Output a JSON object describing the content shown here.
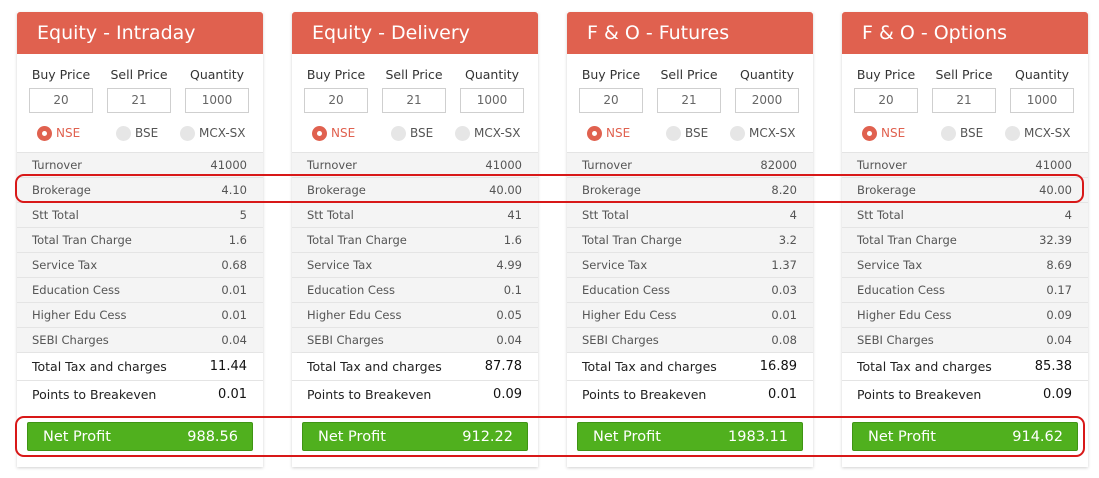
{
  "labels": {
    "buy": "Buy Price",
    "sell": "Sell Price",
    "qty": "Quantity",
    "exchanges": [
      "NSE",
      "BSE",
      "MCX-SX"
    ],
    "rows": [
      "Turnover",
      "Brokerage",
      "Stt Total",
      "Total Tran Charge",
      "Service Tax",
      "Education Cess",
      "Higher Edu Cess",
      "SEBI Charges",
      "Total Tax and charges",
      "Points to Breakeven"
    ],
    "net_profit": "Net Profit"
  },
  "colors": {
    "header": "#e0614f",
    "net": "#50b01e",
    "highlight": "#d81818"
  },
  "cards": [
    {
      "title": "Equity - Intraday",
      "buy": "20",
      "sell": "21",
      "qty": "1000",
      "selected": "NSE",
      "values": [
        "41000",
        "4.10",
        "5",
        "1.6",
        "0.68",
        "0.01",
        "0.01",
        "0.04",
        "11.44",
        "0.01"
      ],
      "net": "988.56"
    },
    {
      "title": "Equity - Delivery",
      "buy": "20",
      "sell": "21",
      "qty": "1000",
      "selected": "NSE",
      "values": [
        "41000",
        "40.00",
        "41",
        "1.6",
        "4.99",
        "0.1",
        "0.05",
        "0.04",
        "87.78",
        "0.09"
      ],
      "net": "912.22"
    },
    {
      "title": "F & O - Futures",
      "buy": "20",
      "sell": "21",
      "qty": "2000",
      "selected": "NSE",
      "values": [
        "82000",
        "8.20",
        "4",
        "3.2",
        "1.37",
        "0.03",
        "0.01",
        "0.08",
        "16.89",
        "0.01"
      ],
      "net": "1983.11"
    },
    {
      "title": "F & O - Options",
      "buy": "20",
      "sell": "21",
      "qty": "1000",
      "selected": "NSE",
      "values": [
        "41000",
        "40.00",
        "4",
        "32.39",
        "8.69",
        "0.17",
        "0.09",
        "0.04",
        "85.38",
        "0.09"
      ],
      "net": "914.62"
    }
  ]
}
